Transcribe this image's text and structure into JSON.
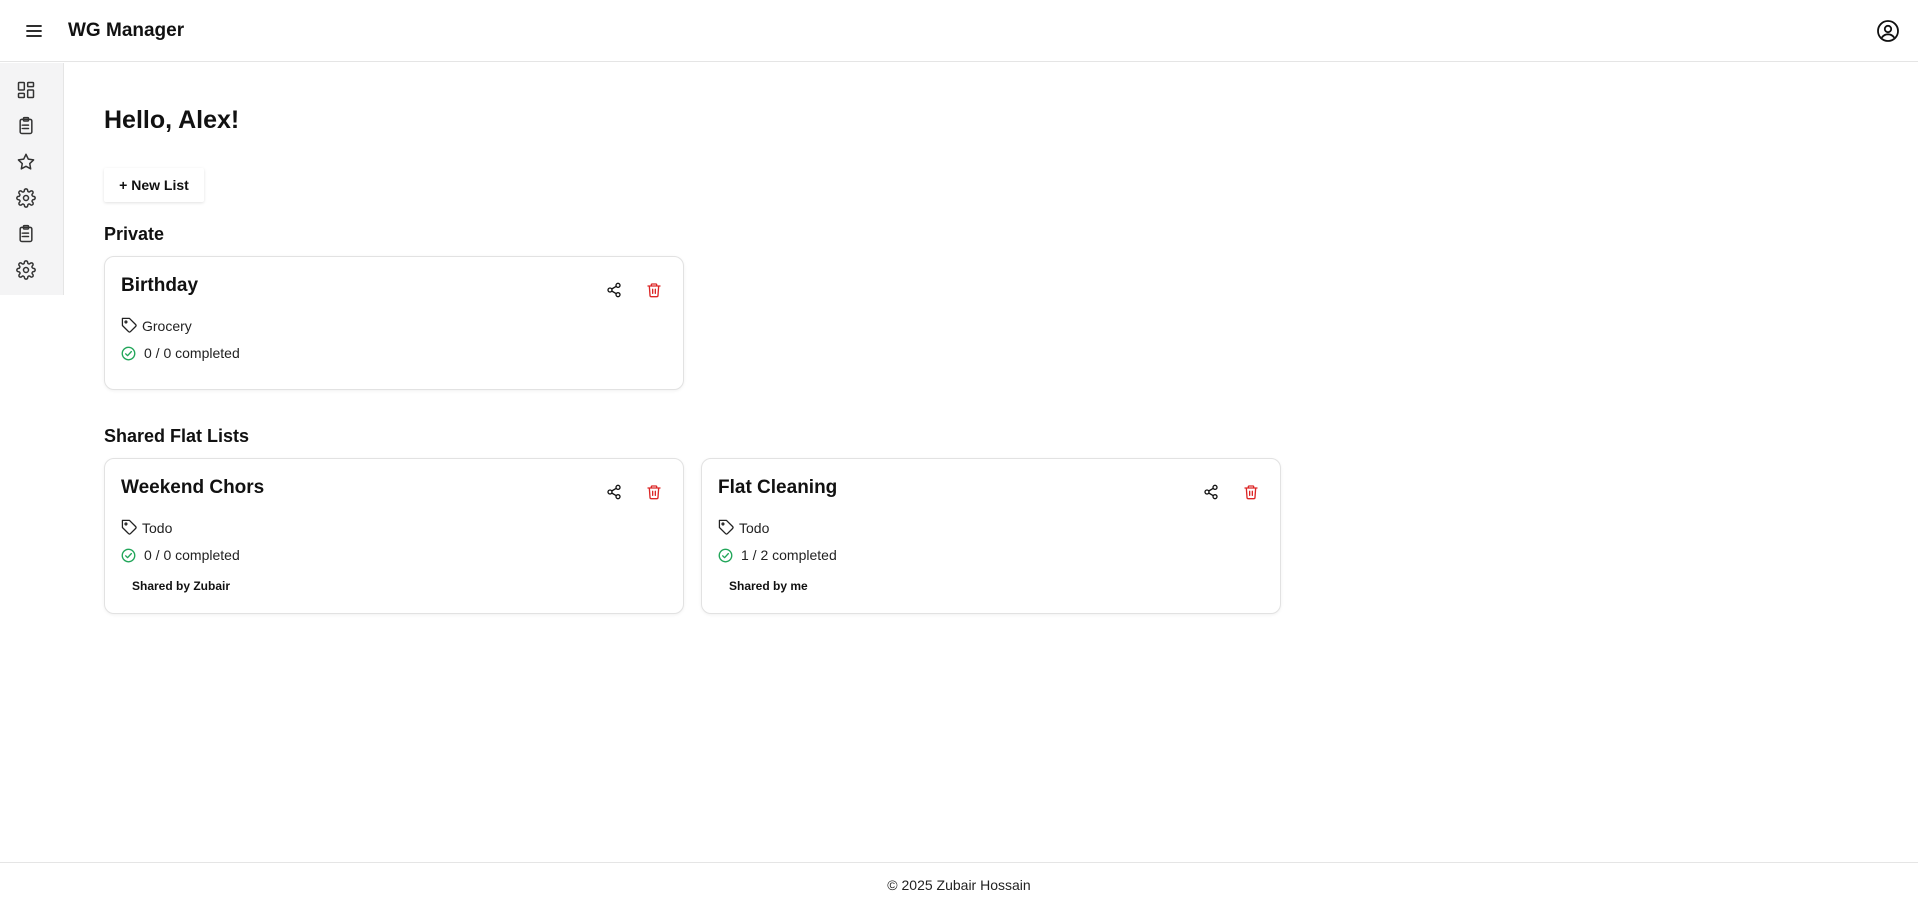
{
  "app": {
    "title": "WG Manager"
  },
  "colors": {
    "check": "#22a65a",
    "delete": "#dc2626",
    "sidebar_bg": "#f4f4f5"
  },
  "sidebar": {
    "items": [
      {
        "icon": "dashboard-icon"
      },
      {
        "icon": "clipboard-list-icon"
      },
      {
        "icon": "star-icon"
      },
      {
        "icon": "gear-icon"
      },
      {
        "icon": "clipboard-list-icon"
      },
      {
        "icon": "gear-icon"
      }
    ]
  },
  "main": {
    "greeting": "Hello, Alex!",
    "new_list_label": "+ New List",
    "sections": [
      {
        "title": "Private",
        "cards": [
          {
            "title": "Birthday",
            "tag": "Grocery",
            "progress": "0 / 0 completed",
            "shared_by": ""
          }
        ]
      },
      {
        "title": "Shared Flat Lists",
        "cards": [
          {
            "title": "Weekend Chors",
            "tag": "Todo",
            "progress": "0 / 0 completed",
            "shared_by": "Shared by Zubair"
          },
          {
            "title": "Flat Cleaning",
            "tag": "Todo",
            "progress": "1 / 2 completed",
            "shared_by": "Shared by me"
          }
        ]
      }
    ]
  },
  "footer": {
    "text": "© 2025 Zubair Hossain"
  }
}
